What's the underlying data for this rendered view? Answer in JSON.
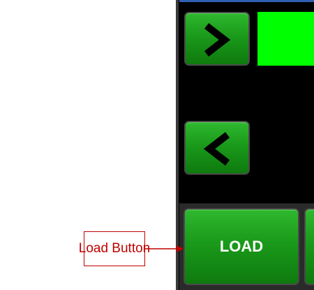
{
  "buttons": {
    "next_icon": "chevron-right-icon",
    "prev_icon": "chevron-left-icon",
    "load_label": "LOAD"
  },
  "annotation": {
    "label": "Load Button"
  },
  "colors": {
    "button_green": "#1a9a1a",
    "display_green": "#00ff00",
    "panel_bg": "#000000",
    "annotation_red": "#c00000"
  }
}
